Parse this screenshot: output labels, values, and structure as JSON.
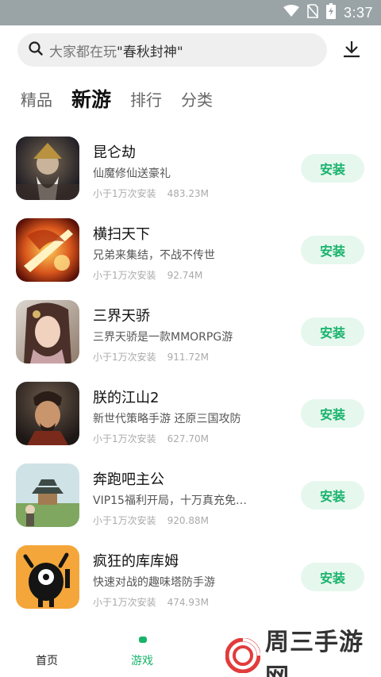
{
  "status_bar": {
    "time": "3:37"
  },
  "search": {
    "prefix": "大家都在玩",
    "highlight": "\"春秋封神\""
  },
  "tabs": [
    {
      "label": "精品"
    },
    {
      "label": "新游"
    },
    {
      "label": "排行"
    },
    {
      "label": "分类"
    }
  ],
  "active_tab": "新游",
  "games": [
    {
      "name": "昆仑劫",
      "desc": "仙魔修仙送豪礼",
      "installs": "小于1万次安装",
      "size": "483.23M",
      "button": "安装"
    },
    {
      "name": "横扫天下",
      "desc": "兄弟来集结，不战不传世",
      "installs": "小于1万次安装",
      "size": "92.74M",
      "button": "安装"
    },
    {
      "name": "三界天骄",
      "desc": "三界天骄是一款MMORPG游",
      "installs": "小于1万次安装",
      "size": "911.72M",
      "button": "安装"
    },
    {
      "name": "朕的江山2",
      "desc": "新世代策略手游 还原三国攻防",
      "installs": "小于1万次安装",
      "size": "627.70M",
      "button": "安装"
    },
    {
      "name": "奔跑吧主公",
      "desc": "VIP15福利开局，十万真充免…",
      "installs": "小于1万次安装",
      "size": "920.88M",
      "button": "安装"
    },
    {
      "name": "疯狂的库库姆",
      "desc": "快速对战的趣味塔防手游",
      "installs": "小于1万次安装",
      "size": "474.93M",
      "button": "安装"
    }
  ],
  "bottom_nav": {
    "home": "首页",
    "games": "游戏"
  },
  "watermark": {
    "text": "周三手游网"
  },
  "colors": {
    "accent": "#18b36b",
    "install_bg": "#e6f7ee",
    "status_bar": "#9aa3a6"
  }
}
